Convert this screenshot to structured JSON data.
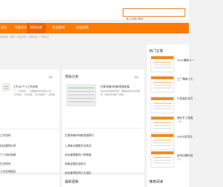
{
  "search": {
    "placeholder": "输入关键词搜索..."
  },
  "nav": [
    "首页",
    "专家点评",
    "项目分析",
    "商业模式",
    "创业指南"
  ],
  "breadcrumb": "当前位置：首页 > 创业分析 > 项目分析 > 专家点评",
  "left_card": {
    "more": "更多",
    "lead_title": "工行50个人工作总结",
    "lead_desc": "一、工作目标：...主要做好本年度的工作……工作目标，工作总结，工作中取得了一定成绩",
    "links": [
      "工作总结",
      "创业案例分享",
      "个人创业指南",
      "生活时尚",
      "工作总结报告",
      "人力资源报告"
    ]
  },
  "mid_card": {
    "title": "项目分析",
    "more": "更多",
    "lead_title": "生意场城市的新思维发展",
    "lead_desc": "创业者在选择项目时，需要综合考虑市场需求、自身条件等多个因素。",
    "links": [
      "生意场城市的新思维探讨",
      "上海街头摊贩生存状况",
      "创业者需要的八种思维",
      "电商运营实战技巧",
      "创业者常犯的几大误区",
      "加盟的五种风险"
    ]
  },
  "sidebar": {
    "title": "热门文章",
    "items": [
      {
        "title": "2022最新十一",
        "sub": ""
      },
      {
        "title": "工厂降级十大",
        "sub": ""
      },
      {
        "title": "宁夏某此本月",
        "sub": ""
      },
      {
        "title": "餐饮手工角落",
        "sub": "个项"
      },
      {
        "title": "500元投资小",
        "sub": ""
      },
      {
        "title": "宏伟红暑年双",
        "sub": "卡大"
      }
    ]
  },
  "bottom": {
    "mid_title": "最新更新",
    "side_title": "推荐阅读"
  }
}
